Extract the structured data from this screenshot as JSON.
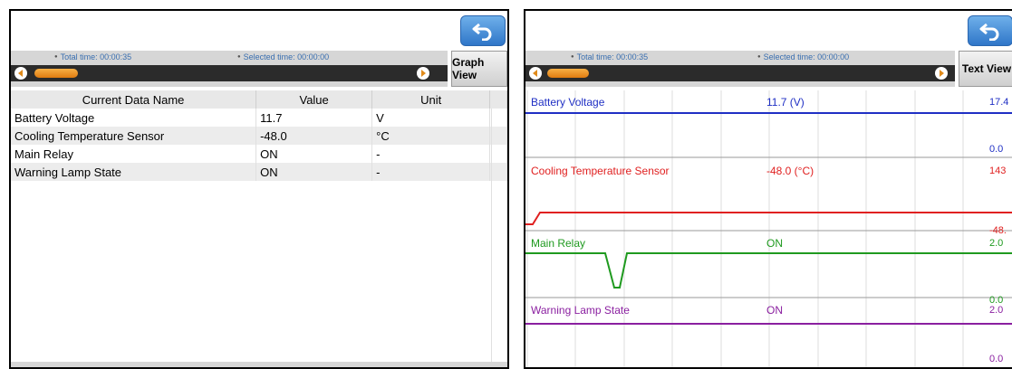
{
  "left_panel": {
    "time": {
      "total": "Total time: 00:00:35",
      "selected": "Selected time: 00:00:00"
    },
    "view_button": "Graph View",
    "table": {
      "headers": [
        "Current Data Name",
        "Value",
        "Unit"
      ],
      "rows": [
        [
          "Battery Voltage",
          "11.7",
          "V"
        ],
        [
          "Cooling Temperature Sensor",
          "-48.0",
          "°C"
        ],
        [
          "Main Relay",
          "ON",
          "-"
        ],
        [
          "Warning Lamp State",
          "ON",
          "-"
        ]
      ]
    }
  },
  "right_panel": {
    "time": {
      "total": "Total time: 00:00:35",
      "selected": "Selected time: 00:00:00"
    },
    "view_button": "Text View",
    "graphs": [
      {
        "name": "Battery Voltage",
        "value": "11.7 (V)",
        "max": "17.4",
        "min": "0.0",
        "color": "#1f2fc4"
      },
      {
        "name": "Cooling Temperature Sensor",
        "value": "-48.0 (°C)",
        "max": "143",
        "min": "-48.",
        "color": "#e02020"
      },
      {
        "name": "Main Relay",
        "value": "ON",
        "max": "2.0",
        "min": "0.0",
        "color": "#1f9a1f"
      },
      {
        "name": "Warning Lamp State",
        "value": "ON",
        "max": "2.0",
        "min": "0.0",
        "color": "#8a1fa0"
      }
    ]
  }
}
